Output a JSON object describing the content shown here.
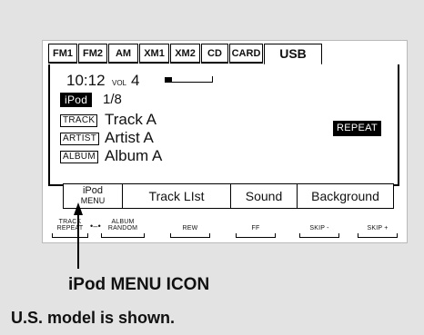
{
  "tabs": [
    "FM1",
    "FM2",
    "AM",
    "XM1",
    "XM2",
    "CD",
    "CARD",
    "USB"
  ],
  "active_tab": "USB",
  "display": {
    "clock": "10:12",
    "vol_label": "VOL",
    "vol_value": "4",
    "vol_level_fraction": 0.15,
    "source_badge": "iPod",
    "track_position": "1/8",
    "track_tag": "TRACK",
    "track_name": "Track A",
    "artist_tag": "ARTIST",
    "artist_name": "Artist A",
    "album_tag": "ALBUM",
    "album_name": "Album A",
    "repeat_badge": "REPEAT"
  },
  "menu": {
    "ipod_menu_line1": "iPod",
    "ipod_menu_line2": "MENU",
    "track_list": "Track LIst",
    "sound": "Sound",
    "background": "Background"
  },
  "function_keys": {
    "track_repeat_line1": "TRACK",
    "track_repeat_line2": "REPEAT",
    "album_random_line1": "ALBUM",
    "album_random_line2": "RANDOM",
    "rew": "REW",
    "ff": "FF",
    "skip_minus": "SKIP -",
    "skip_plus": "SKIP +"
  },
  "callout": "iPod MENU ICON",
  "caption": "U.S. model is shown."
}
